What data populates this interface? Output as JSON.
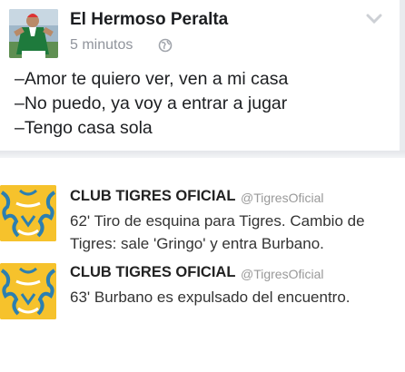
{
  "fb_post": {
    "author": "El Hermoso Peralta",
    "time": "5 minutos",
    "lines": [
      "–Amor te quiero ver, ven a mi casa",
      "–No puedo, ya voy a entrar a jugar",
      "–Tengo casa sola"
    ],
    "icons": {
      "privacy": "globe-icon",
      "menu": "chevron-down-icon"
    }
  },
  "tweets": [
    {
      "name": "CLUB TIGRES OFICIAL",
      "handle": "@TigresOficial",
      "lines": [
        "62' Tiro de esquina para Tigres. Cambio de",
        "Tigres: sale 'Gringo' y entra Burbano."
      ]
    },
    {
      "name": "CLUB TIGRES OFICIAL",
      "handle": "@TigresOficial",
      "lines": [
        "63' Burbano es expulsado del encuentro."
      ]
    }
  ],
  "colors": {
    "tigres_yellow": "#f6c22c",
    "tigres_blue": "#2c7fb0",
    "mexico_green": "#1e7a3c"
  }
}
